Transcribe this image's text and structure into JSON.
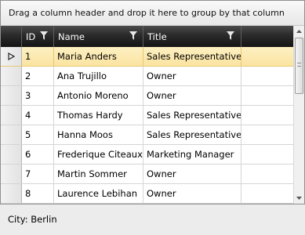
{
  "group_panel": {
    "text": "Drag a column header and drop it here to group by that column"
  },
  "columns": [
    {
      "label": "ID",
      "filter_icon": "filter-icon"
    },
    {
      "label": "Name",
      "filter_icon": "filter-icon"
    },
    {
      "label": "Title",
      "filter_icon": "filter-icon"
    }
  ],
  "rows": [
    {
      "id": "1",
      "name": "Maria Anders",
      "title": "Sales Representative",
      "selected": true
    },
    {
      "id": "2",
      "name": "Ana Trujillo",
      "title": "Owner"
    },
    {
      "id": "3",
      "name": "Antonio Moreno",
      "title": "Owner"
    },
    {
      "id": "4",
      "name": "Thomas Hardy",
      "title": "Sales Representative"
    },
    {
      "id": "5",
      "name": "Hanna Moos",
      "title": "Sales Representative"
    },
    {
      "id": "6",
      "name": "Frederique Citeaux",
      "title": "Marketing Manager"
    },
    {
      "id": "7",
      "name": "Martin Sommer",
      "title": "Owner"
    },
    {
      "id": "8",
      "name": "Laurence Lebihan",
      "title": "Owner"
    }
  ],
  "status": {
    "text": "City: Berlin"
  },
  "colors": {
    "header_bg": "#2a2a2a",
    "selected_row": "#fbe4a2",
    "border": "#8e8f8f"
  }
}
